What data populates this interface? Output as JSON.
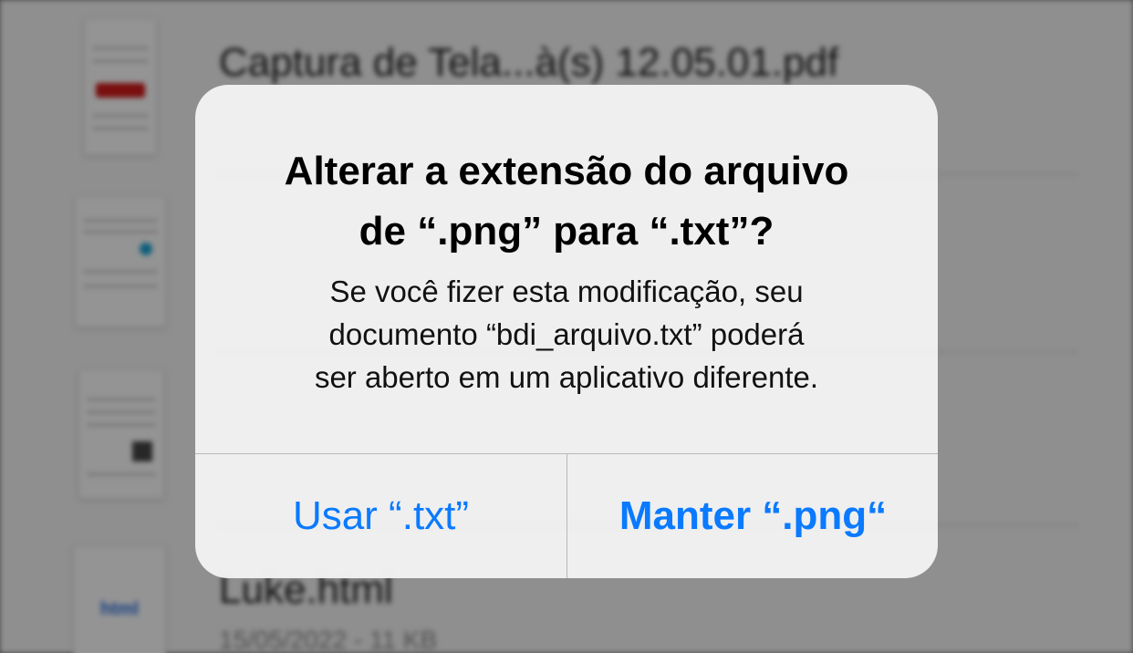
{
  "background": {
    "files": [
      {
        "name": "Captura de Tela...à(s) 12.05.01.pdf",
        "meta": ""
      },
      {
        "name": "",
        "meta": ""
      },
      {
        "name": "",
        "meta": ""
      },
      {
        "name": "Luke.html",
        "meta": "15/05/2022 - 11 KB",
        "thumb_label": "html"
      }
    ]
  },
  "alert": {
    "title_line1": "Alterar a extensão do arquivo",
    "title_line2": "de “.png” para “.txt”?",
    "message_line1": "Se você fizer esta modificação, seu",
    "message_line2": "documento “bdi_arquivo.txt” poderá",
    "message_line3": "ser aberto em um aplicativo diferente.",
    "button_use": "Usar “.txt”",
    "button_keep": "Manter “.png“"
  },
  "colors": {
    "accent": "#0a7aff",
    "dialog_bg": "#f2f2f2",
    "dim": "#7d7d7d"
  }
}
